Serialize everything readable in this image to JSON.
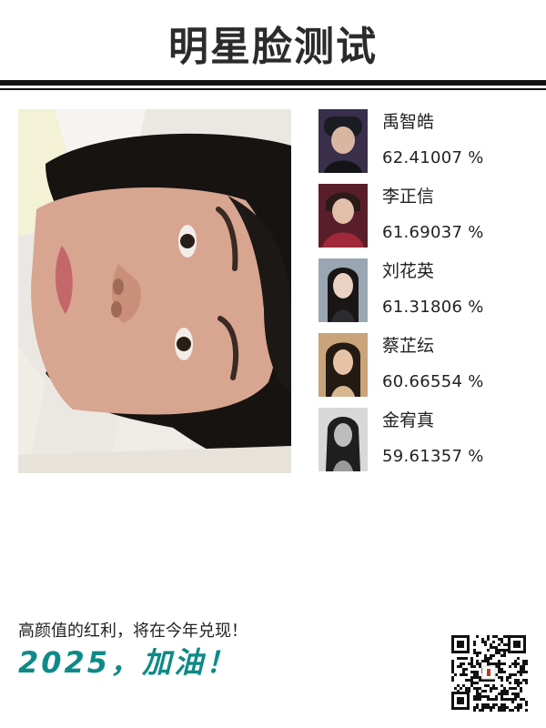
{
  "header": {
    "title": "明星脸测试"
  },
  "results": [
    {
      "name": "禹智皓",
      "score": "62.41007 %"
    },
    {
      "name": "李正信",
      "score": "61.69037 %"
    },
    {
      "name": "刘花英",
      "score": "61.31806 %"
    },
    {
      "name": "蔡芷纭",
      "score": "60.66554 %"
    },
    {
      "name": "金宥真",
      "score": "59.61357 %"
    }
  ],
  "footer": {
    "slogan": "高颜值的红利，将在今年兑现！",
    "year_line": "2025，加油！"
  },
  "colors": {
    "accent": "#0e8a88",
    "rule": "#111111"
  }
}
